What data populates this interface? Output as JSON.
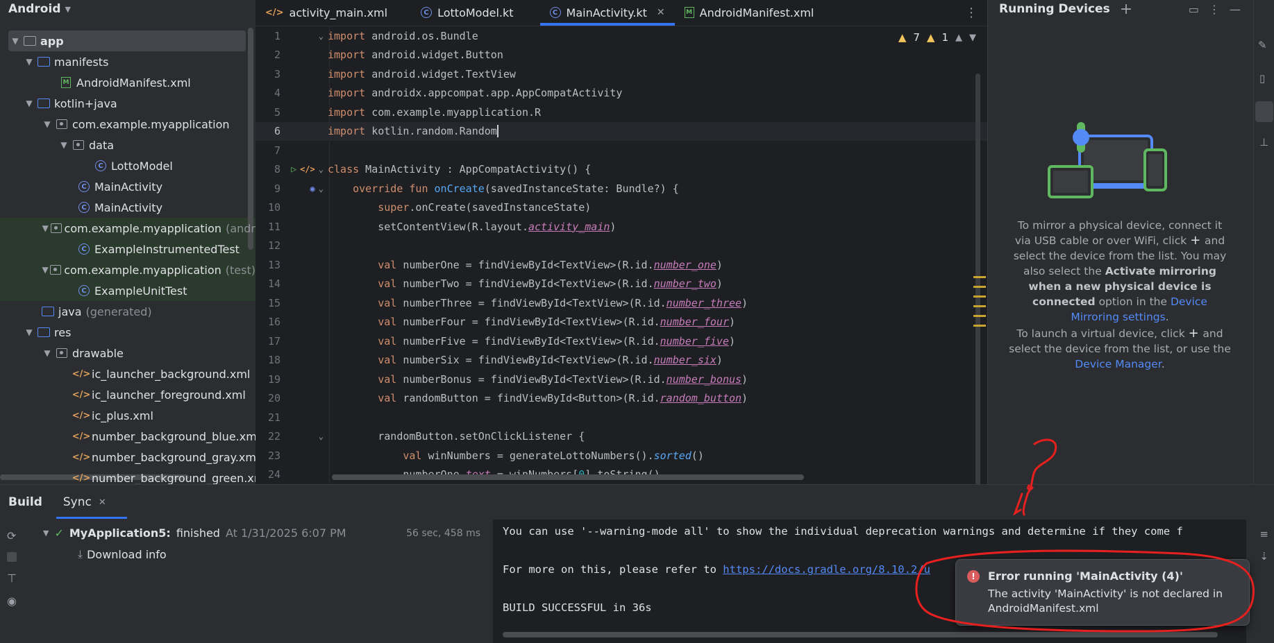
{
  "project": {
    "view_label": "Android",
    "tree": [
      {
        "label": "app",
        "type": "module"
      },
      {
        "label": "manifests",
        "type": "folder"
      },
      {
        "label": "AndroidManifest.xml",
        "type": "manifest"
      },
      {
        "label": "kotlin+java",
        "type": "folder"
      },
      {
        "label": "com.example.myapplication",
        "type": "package"
      },
      {
        "label": "data",
        "type": "package"
      },
      {
        "label": "LottoModel",
        "type": "class"
      },
      {
        "label": "MainActivity",
        "type": "class"
      },
      {
        "label": "MainActivity",
        "type": "class"
      },
      {
        "label": "com.example.myapplication",
        "suffix": "(andr",
        "type": "package"
      },
      {
        "label": "ExampleInstrumentedTest",
        "type": "class"
      },
      {
        "label": "com.example.myapplication",
        "suffix": "(test)",
        "type": "package"
      },
      {
        "label": "ExampleUnitTest",
        "type": "class"
      },
      {
        "label": "java",
        "suffix": "(generated)",
        "type": "folder"
      },
      {
        "label": "res",
        "type": "folder"
      },
      {
        "label": "drawable",
        "type": "folder"
      },
      {
        "label": "ic_launcher_background.xml",
        "type": "xml"
      },
      {
        "label": "ic_launcher_foreground.xml",
        "type": "xml"
      },
      {
        "label": "ic_plus.xml",
        "type": "xml"
      },
      {
        "label": "number_background_blue.xml",
        "type": "xml"
      },
      {
        "label": "number_background_gray.xml",
        "type": "xml"
      },
      {
        "label": "number_background_green.xm",
        "type": "xml"
      }
    ]
  },
  "editor": {
    "tabs": [
      {
        "label": "activity_main.xml",
        "icon": "xml-icon"
      },
      {
        "label": "LottoModel.kt",
        "icon": "kotlin-class-icon"
      },
      {
        "label": "MainActivity.kt",
        "icon": "kotlin-class-icon",
        "active": true
      },
      {
        "label": "AndroidManifest.xml",
        "icon": "manifest-icon"
      }
    ],
    "inspections": {
      "warnings": "7",
      "weak_warnings": "1"
    },
    "line_numbers": [
      "1",
      "2",
      "3",
      "4",
      "5",
      "6",
      "7",
      "8",
      "9",
      "10",
      "11",
      "12",
      "13",
      "14",
      "15",
      "16",
      "17",
      "18",
      "19",
      "20",
      "21",
      "22",
      "23",
      "24"
    ]
  },
  "running_devices": {
    "title": "Running Devices",
    "text1_a": "To mirror a physical device, connect it via USB cable or over WiFi, click",
    "text1_b": "and select the device from the list. You may also select the",
    "text1_bold": "Activate mirroring when a new physical device is connected",
    "text1_c": "option in the",
    "text1_link": "Device Mirroring settings",
    "text2_a": "To launch a virtual device, click",
    "text2_b": "and select the device from the list, or use the",
    "text2_link": "Device Manager"
  },
  "build": {
    "tab_build": "Build",
    "tab_sync": "Sync",
    "task_name": "MyApplication5:",
    "task_status": "finished",
    "task_time": "At 1/31/2025 6:07 PM",
    "task_duration": "56 sec, 458 ms",
    "subtask": "Download info",
    "console": {
      "line1": "You can use '--warning-mode all' to show the individual deprecation warnings and determine if they come f",
      "line2_prefix": "For more on this, please refer to ",
      "line2_url": "https://docs.gradle.org/8.10.2/u",
      "line3": "BUILD SUCCESSFUL in 36s"
    }
  },
  "notification": {
    "title": "Error running 'MainActivity (4)'",
    "body": "The activity 'MainActivity' is not declared in AndroidManifest.xml"
  },
  "colors": {
    "accent": "#3574f0",
    "error": "#db5c5c",
    "annotation": "#e5201e"
  }
}
